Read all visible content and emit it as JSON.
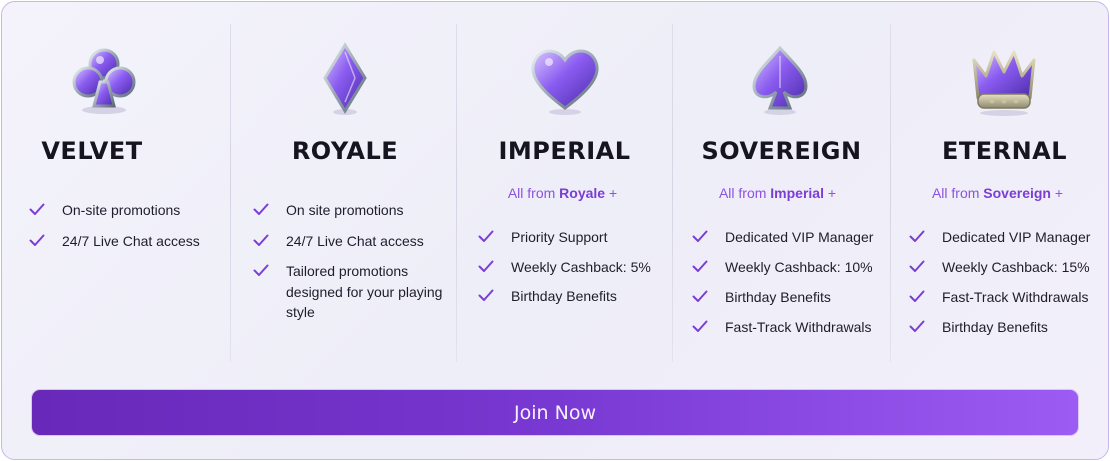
{
  "tiers": [
    {
      "name": "VELVET",
      "icon": "club-icon",
      "inherit": null,
      "benefits": [
        "On-site promotions",
        "24/7 Live Chat access"
      ]
    },
    {
      "name": "ROYALE",
      "icon": "diamond-icon",
      "inherit": null,
      "benefits": [
        "On site promotions",
        "24/7 Live Chat access",
        "Tailored promotions designed for your playing style"
      ]
    },
    {
      "name": "IMPERIAL",
      "icon": "heart-icon",
      "inherit": {
        "prefix": "All from",
        "tier": "Royale",
        "suffix": "+"
      },
      "benefits": [
        "Priority Support",
        "Weekly Cashback: 5%",
        "Birthday Benefits"
      ]
    },
    {
      "name": "SOVEREIGN",
      "icon": "spade-icon",
      "inherit": {
        "prefix": "All from",
        "tier": "Imperial",
        "suffix": "+"
      },
      "benefits": [
        "Dedicated VIP Manager",
        "Weekly Cashback: 10%",
        "Birthday Benefits",
        "Fast-Track Withdrawals"
      ]
    },
    {
      "name": "ETERNAL",
      "icon": "crown-icon",
      "inherit": {
        "prefix": "All from",
        "tier": "Sovereign",
        "suffix": "+"
      },
      "benefits": [
        "Dedicated VIP Manager",
        "Weekly Cashback: 15%",
        "Fast-Track Withdrawals",
        "Birthday Benefits"
      ]
    }
  ],
  "cta": {
    "label": "Join Now"
  },
  "colors": {
    "accent": "#8c52e0",
    "check": "#7a3ed6",
    "button_start": "#6828b8",
    "button_end": "#9c5cf4",
    "heading": "#16141f"
  }
}
